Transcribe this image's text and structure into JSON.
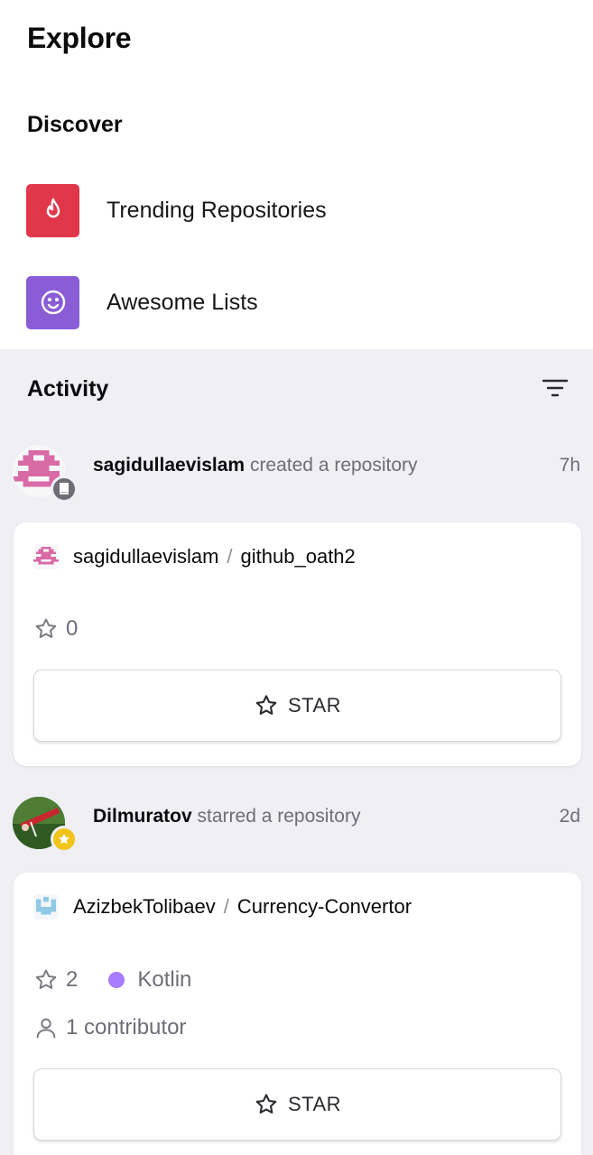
{
  "header": {
    "title": "Explore"
  },
  "discover": {
    "title": "Discover",
    "items": [
      {
        "label": "Trending Repositories",
        "icon": "flame-icon",
        "color": "#e0384a"
      },
      {
        "label": "Awesome Lists",
        "icon": "smiley-icon",
        "color": "#8a5cd6"
      }
    ]
  },
  "activity": {
    "title": "Activity",
    "events": [
      {
        "user": "sagidullaevislam",
        "action": "created a repository",
        "time": "7h",
        "badge_icon": "repo-icon",
        "repo": {
          "owner": "sagidullaevislam",
          "name": "github_oath2",
          "stars": "0",
          "star_button": "STAR"
        }
      },
      {
        "user": "Dilmuratov",
        "action": "starred a repository",
        "time": "2d",
        "badge_icon": "star-icon",
        "repo": {
          "owner": "AzizbekTolibaev",
          "name": "Currency-Convertor",
          "stars": "2",
          "language": "Kotlin",
          "language_color": "#a97bff",
          "contributors": "1 contributor",
          "star_button": "STAR"
        }
      }
    ]
  }
}
